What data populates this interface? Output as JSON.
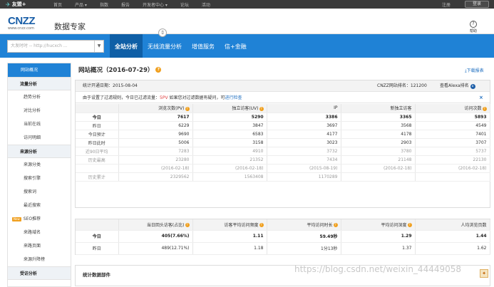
{
  "topbar": {
    "logo": "友盟+",
    "nav": [
      "首页",
      "产品 ▾",
      "指数",
      "报告",
      "开发者中心 ▾",
      "论坛",
      "活动"
    ],
    "register": "注册",
    "login": "登录"
  },
  "header": {
    "brand": "CNZZ",
    "brand_url": "www.cnzz.com",
    "product": "数据专家",
    "help": "帮助"
  },
  "bluebar": {
    "search_placeholder": "大发时时 -- http://hucxch ...",
    "tabs": [
      "全站分析",
      "无线流量分析",
      "增值服务",
      "信+金融"
    ]
  },
  "sidebar": {
    "items": [
      {
        "label": "网站概况",
        "type": "current"
      },
      {
        "label": "流量分析",
        "type": "section"
      },
      {
        "label": "趋势分析",
        "type": "item"
      },
      {
        "label": "对比分析",
        "type": "item"
      },
      {
        "label": "当前在线",
        "type": "item"
      },
      {
        "label": "访问明细",
        "type": "item"
      },
      {
        "label": "来源分析",
        "type": "section"
      },
      {
        "label": "来源分类",
        "type": "item"
      },
      {
        "label": "搜索引擎",
        "type": "item"
      },
      {
        "label": "搜索词",
        "type": "item"
      },
      {
        "label": "最近搜索",
        "type": "item"
      },
      {
        "label": "SEO推荐",
        "type": "new",
        "badge": "New"
      },
      {
        "label": "来路域名",
        "type": "item"
      },
      {
        "label": "来路页面",
        "type": "item"
      },
      {
        "label": "来源升降榜",
        "type": "item"
      },
      {
        "label": "受访分析",
        "type": "section"
      }
    ]
  },
  "main": {
    "title": "网站概况（2016-07-29）",
    "download": "下载报表",
    "info": {
      "start": "统计开通日期：2015-08-04",
      "rank": "CNZZ网站排名：121200",
      "alexa": "查看Alexa排名"
    },
    "warn": {
      "prefix": "由于设置了过滤规则，今日已过滤流量：",
      "pv": "5PV",
      "mid": "   如果您对过滤数据有疑问，可",
      "link": "进行检查",
      "close": "×"
    },
    "table1": {
      "headers": [
        "",
        "浏览次数(PV)",
        "独立访客(UV)",
        "IP",
        "新独立访客",
        "访问次数"
      ],
      "rows": [
        {
          "label": "今日",
          "values": [
            "7617",
            "5290",
            "3386",
            "3365",
            "5893"
          ],
          "style": "today"
        },
        {
          "label": "昨日",
          "values": [
            "6229",
            "3847",
            "3697",
            "3568",
            "4549"
          ],
          "style": ""
        },
        {
          "label": "今日预计",
          "values": [
            "9690",
            "6583",
            "4177",
            "4178",
            "7401"
          ],
          "style": ""
        },
        {
          "label": "昨日此时",
          "values": [
            "5006",
            "3158",
            "3023",
            "2903",
            "3707"
          ],
          "style": ""
        },
        {
          "label": "近90日平均",
          "values": [
            "7283",
            "4910",
            "3732",
            "3780",
            "5737"
          ],
          "style": "grey"
        },
        {
          "label": "历史最高",
          "values": [
            "23280",
            "21352",
            "7434",
            "21148",
            "22130"
          ],
          "style": "grey"
        },
        {
          "label": "",
          "values": [
            "(2016-02-18)",
            "(2016-02-18)",
            "(2015-08-19)",
            "(2016-02-18)",
            "(2016-02-18)"
          ],
          "style": "grey"
        },
        {
          "label": "历史累计",
          "values": [
            "2329562",
            "1563408",
            "1170289",
            "",
            ""
          ],
          "style": "grey"
        }
      ]
    },
    "table2": {
      "headers": [
        "",
        "当日回头访客(占比)",
        "访客平均访问频度",
        "平均访问时长",
        "平均访问深度",
        "人均浏览页数"
      ],
      "rows": [
        {
          "label": "今日",
          "values": [
            "405(7.66%)",
            "1.11",
            "59.49秒",
            "1.29",
            "1.44"
          ],
          "style": "today"
        },
        {
          "label": "昨日",
          "values": [
            "489(12.71%)",
            "1.18",
            "1分13秒",
            "1.37",
            "1.62"
          ],
          "style": ""
        }
      ]
    },
    "panel3_title": "统计数据部件"
  },
  "watermark": "https://blog.csdn.net/weixin_44449058"
}
